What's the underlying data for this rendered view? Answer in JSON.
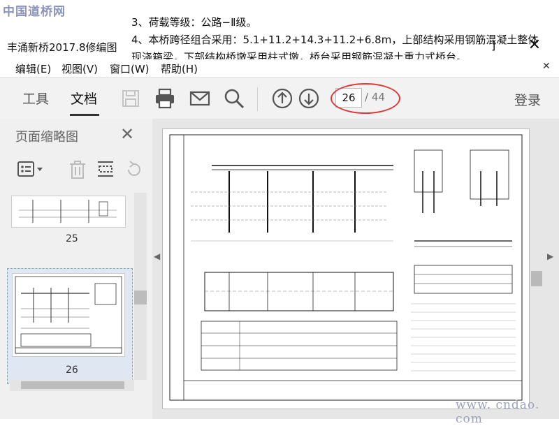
{
  "watermark": {
    "top_left": "中国道桥网",
    "bottom_right": "www. cndao. com"
  },
  "window": {
    "title": "丰涌新桥2017.8修编图",
    "restore_glyph": "]",
    "close_glyph": "✕"
  },
  "overlay_text": [
    "3、荷载等级：公路−Ⅱ级。",
    "4、本桥跨径组合采用：5.1+11.2+14.3+11.2+6.8m，上部结构采用钢筋混凝土整体",
    "现浇箱梁，下部结构桥墩采用柱式墩，桥台采用钢筋混凝土重力式桥台。"
  ],
  "menu": {
    "items": [
      "编辑(E)",
      "视图(V)",
      "窗口(W)",
      "帮助(H)"
    ],
    "close_glyph": "✕"
  },
  "toolbar": {
    "tabs": [
      "工具",
      "文档"
    ],
    "active_tab": "文档",
    "current_page": "26",
    "total_pages": "/ 44",
    "login_label": "登录",
    "icons": [
      "save-icon",
      "print-icon",
      "email-icon",
      "search-icon",
      "page-up-icon",
      "page-down-icon"
    ]
  },
  "sidebar": {
    "title": "页面缩略图",
    "close_glyph": "✕",
    "thumbnails": [
      {
        "label": "25"
      },
      {
        "label": "26"
      }
    ]
  },
  "colors": {
    "accent_circle": "#d93b3b",
    "toolbar_bg": "#f2f2f2",
    "sidebar_bg": "#f0f0f0"
  }
}
